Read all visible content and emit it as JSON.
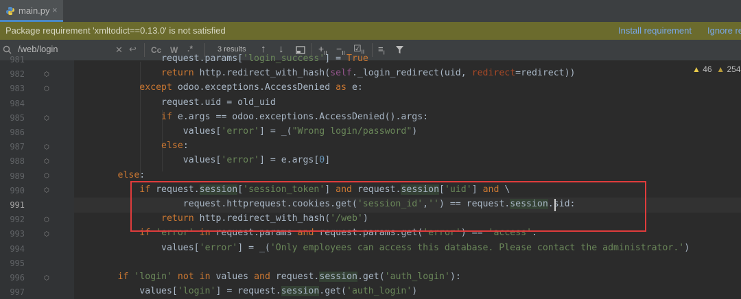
{
  "tab": {
    "filename": "main.py",
    "close_glyph": "×",
    "icon": "python-file-icon"
  },
  "banner": {
    "message": "Package requirement 'xmltodict==0.13.0' is not satisfied",
    "install_link": "Install requirement",
    "ignore_link": "Ignore re"
  },
  "search": {
    "query": "/web/login",
    "results": "3 results",
    "match_case": "Cc",
    "words": "W",
    "regex": ".*"
  },
  "inspections": {
    "warnings_a": "46",
    "warnings_b": "254"
  },
  "line_numbers": [
    "981",
    "982",
    "983",
    "984",
    "985",
    "986",
    "987",
    "988",
    "989",
    "990",
    "991",
    "992",
    "993",
    "994",
    "995",
    "996",
    "997"
  ],
  "colors": {
    "accent": "#4a88c7",
    "banner_bg": "#6b6b2d",
    "highlight_box": "#e03c3c"
  }
}
